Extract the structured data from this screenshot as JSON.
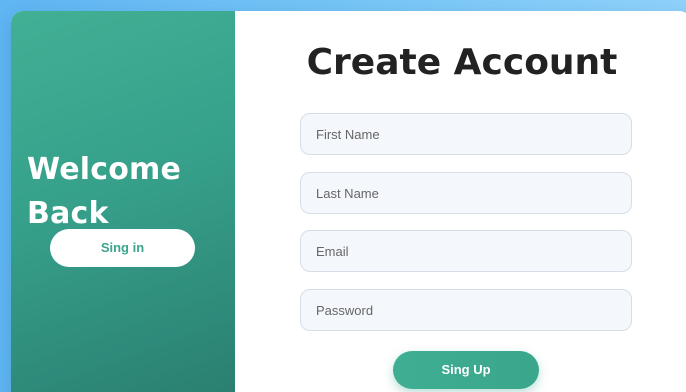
{
  "colors": {
    "page_background": "#6cbef5",
    "panel_accent": "#3aa58c",
    "panel_accent_dark": "#2a7e70",
    "card_background": "#ffffff",
    "field_background": "#f4f7fb",
    "field_border": "#d5dee8",
    "title_text": "#222222"
  },
  "left_panel": {
    "title": "Welcome Back",
    "signin_label": "Sing in"
  },
  "form": {
    "title": "Create Account",
    "fields": {
      "first_name": {
        "placeholder": "First Name",
        "value": ""
      },
      "last_name": {
        "placeholder": "Last Name",
        "value": ""
      },
      "email": {
        "placeholder": "Email",
        "value": ""
      },
      "password": {
        "placeholder": "Password",
        "value": ""
      }
    },
    "submit_label": "Sing Up"
  }
}
